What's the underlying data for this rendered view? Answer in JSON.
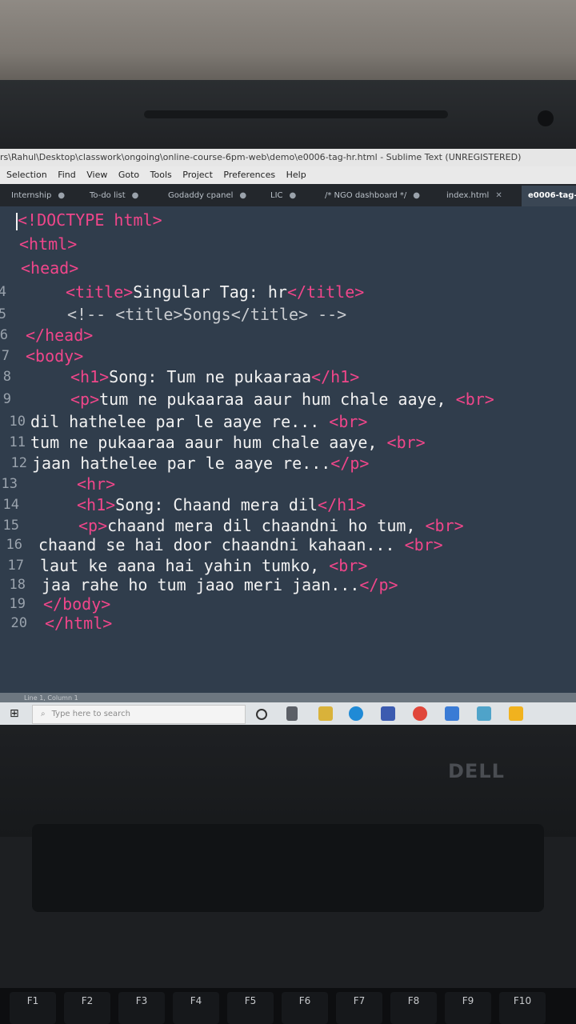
{
  "window": {
    "title": "rs\\Rahul\\Desktop\\classwork\\ongoing\\online-course-6pm-web\\demo\\e0006-tag-hr.html - Sublime Text (UNREGISTERED)"
  },
  "menubar": [
    "Selection",
    "Find",
    "View",
    "Goto",
    "Tools",
    "Project",
    "Preferences",
    "Help"
  ],
  "tabs": [
    {
      "label": "Internship",
      "marker": "●"
    },
    {
      "label": "To-do list",
      "marker": "●"
    },
    {
      "label": "Godaddy cpanel",
      "marker": "●"
    },
    {
      "label": "LIC",
      "marker": "●"
    },
    {
      "label": "/* NGO dashboard */",
      "marker": "●"
    },
    {
      "label": "index.html",
      "marker": "✕"
    },
    {
      "label": "e0006-tag-h",
      "marker": ""
    }
  ],
  "editor": {
    "line_numbers": [
      "",
      "",
      "",
      "4",
      "5",
      "6",
      "7",
      "8",
      "9",
      "10",
      "11",
      "12",
      "13",
      "14",
      "15",
      "16",
      "17",
      "18",
      "19",
      "20"
    ],
    "lines": [
      [
        "<!DOCTYPE",
        " html>"
      ],
      [
        "<html>"
      ],
      [
        "<head>"
      ],
      [
        "<title>",
        "Singular Tag: hr",
        "</title>"
      ],
      [
        "<!-- <title>Songs</title> -->"
      ],
      [
        "</head>"
      ],
      [
        "<body>"
      ],
      [
        "<h1>",
        "Song: Tum ne pukaaraa",
        "</h1>"
      ],
      [
        "<p>",
        "tum ne pukaaraa aaur hum chale aaye, ",
        "<br>"
      ],
      [
        "dil hathelee par le aaye re... ",
        "<br>"
      ],
      [
        "tum ne pukaaraa aaur hum chale aaye, ",
        "<br>"
      ],
      [
        "jaan hathelee par le aaye re...",
        "</p>"
      ],
      [
        "<hr>"
      ],
      [
        "<h1>",
        "Song: Chaand mera dil",
        "</h1>"
      ],
      [
        "<p>",
        "chaand mera dil chaandni ho tum, ",
        "<br>"
      ],
      [
        "chaand se hai door chaandni kahaan... ",
        "<br>"
      ],
      [
        "laut ke aana hai yahin tumko, ",
        "<br>"
      ],
      [
        "jaa rahe ho tum jaao meri jaan...",
        "</p>"
      ],
      [
        "</body>"
      ],
      [
        "</html>"
      ]
    ]
  },
  "statusbar": {
    "text": "Line 1, Column 1"
  },
  "taskbar": {
    "search_placeholder": "Type here to search"
  },
  "laptop": {
    "brand": "DELL"
  },
  "keys": [
    "F1",
    "F2",
    "F3",
    "F4",
    "F5",
    "F6",
    "F7",
    "F8",
    "F9",
    "F10"
  ],
  "colors": {
    "editor_bg": "#303d4c",
    "tag": "#f0468a",
    "text": "#f2f2f2"
  }
}
